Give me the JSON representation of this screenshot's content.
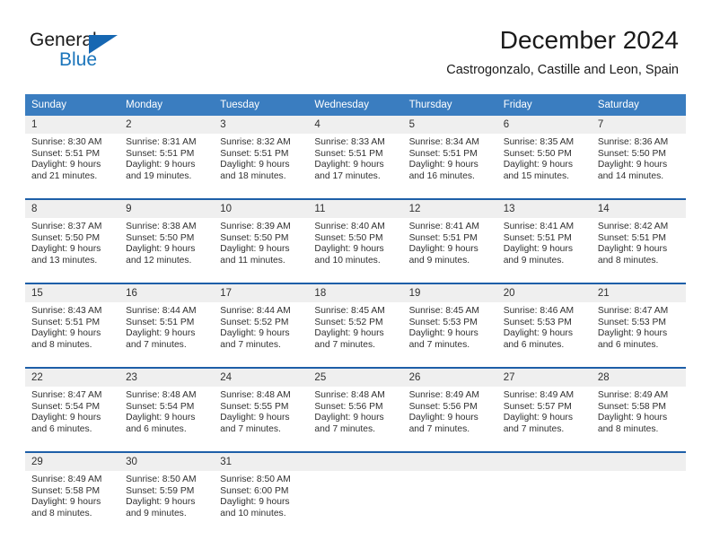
{
  "logo": {
    "word_one": "General",
    "word_two": "Blue",
    "triangle_icon": "blue-triangle-icon",
    "accent_color": "#1b75bb"
  },
  "header": {
    "title": "December 2024",
    "location": "Castrogonzalo, Castille and Leon, Spain"
  },
  "calendar": {
    "header_color": "#3a7dc0",
    "separator_color": "#1e5fa8",
    "daynum_band_color": "#efefef",
    "weekday_headers": [
      "Sunday",
      "Monday",
      "Tuesday",
      "Wednesday",
      "Thursday",
      "Friday",
      "Saturday"
    ],
    "weeks": [
      [
        {
          "day": "1",
          "sunrise": "Sunrise: 8:30 AM",
          "sunset": "Sunset: 5:51 PM",
          "daylight_1": "Daylight: 9 hours",
          "daylight_2": "and 21 minutes."
        },
        {
          "day": "2",
          "sunrise": "Sunrise: 8:31 AM",
          "sunset": "Sunset: 5:51 PM",
          "daylight_1": "Daylight: 9 hours",
          "daylight_2": "and 19 minutes."
        },
        {
          "day": "3",
          "sunrise": "Sunrise: 8:32 AM",
          "sunset": "Sunset: 5:51 PM",
          "daylight_1": "Daylight: 9 hours",
          "daylight_2": "and 18 minutes."
        },
        {
          "day": "4",
          "sunrise": "Sunrise: 8:33 AM",
          "sunset": "Sunset: 5:51 PM",
          "daylight_1": "Daylight: 9 hours",
          "daylight_2": "and 17 minutes."
        },
        {
          "day": "5",
          "sunrise": "Sunrise: 8:34 AM",
          "sunset": "Sunset: 5:51 PM",
          "daylight_1": "Daylight: 9 hours",
          "daylight_2": "and 16 minutes."
        },
        {
          "day": "6",
          "sunrise": "Sunrise: 8:35 AM",
          "sunset": "Sunset: 5:50 PM",
          "daylight_1": "Daylight: 9 hours",
          "daylight_2": "and 15 minutes."
        },
        {
          "day": "7",
          "sunrise": "Sunrise: 8:36 AM",
          "sunset": "Sunset: 5:50 PM",
          "daylight_1": "Daylight: 9 hours",
          "daylight_2": "and 14 minutes."
        }
      ],
      [
        {
          "day": "8",
          "sunrise": "Sunrise: 8:37 AM",
          "sunset": "Sunset: 5:50 PM",
          "daylight_1": "Daylight: 9 hours",
          "daylight_2": "and 13 minutes."
        },
        {
          "day": "9",
          "sunrise": "Sunrise: 8:38 AM",
          "sunset": "Sunset: 5:50 PM",
          "daylight_1": "Daylight: 9 hours",
          "daylight_2": "and 12 minutes."
        },
        {
          "day": "10",
          "sunrise": "Sunrise: 8:39 AM",
          "sunset": "Sunset: 5:50 PM",
          "daylight_1": "Daylight: 9 hours",
          "daylight_2": "and 11 minutes."
        },
        {
          "day": "11",
          "sunrise": "Sunrise: 8:40 AM",
          "sunset": "Sunset: 5:50 PM",
          "daylight_1": "Daylight: 9 hours",
          "daylight_2": "and 10 minutes."
        },
        {
          "day": "12",
          "sunrise": "Sunrise: 8:41 AM",
          "sunset": "Sunset: 5:51 PM",
          "daylight_1": "Daylight: 9 hours",
          "daylight_2": "and 9 minutes."
        },
        {
          "day": "13",
          "sunrise": "Sunrise: 8:41 AM",
          "sunset": "Sunset: 5:51 PM",
          "daylight_1": "Daylight: 9 hours",
          "daylight_2": "and 9 minutes."
        },
        {
          "day": "14",
          "sunrise": "Sunrise: 8:42 AM",
          "sunset": "Sunset: 5:51 PM",
          "daylight_1": "Daylight: 9 hours",
          "daylight_2": "and 8 minutes."
        }
      ],
      [
        {
          "day": "15",
          "sunrise": "Sunrise: 8:43 AM",
          "sunset": "Sunset: 5:51 PM",
          "daylight_1": "Daylight: 9 hours",
          "daylight_2": "and 8 minutes."
        },
        {
          "day": "16",
          "sunrise": "Sunrise: 8:44 AM",
          "sunset": "Sunset: 5:51 PM",
          "daylight_1": "Daylight: 9 hours",
          "daylight_2": "and 7 minutes."
        },
        {
          "day": "17",
          "sunrise": "Sunrise: 8:44 AM",
          "sunset": "Sunset: 5:52 PM",
          "daylight_1": "Daylight: 9 hours",
          "daylight_2": "and 7 minutes."
        },
        {
          "day": "18",
          "sunrise": "Sunrise: 8:45 AM",
          "sunset": "Sunset: 5:52 PM",
          "daylight_1": "Daylight: 9 hours",
          "daylight_2": "and 7 minutes."
        },
        {
          "day": "19",
          "sunrise": "Sunrise: 8:45 AM",
          "sunset": "Sunset: 5:53 PM",
          "daylight_1": "Daylight: 9 hours",
          "daylight_2": "and 7 minutes."
        },
        {
          "day": "20",
          "sunrise": "Sunrise: 8:46 AM",
          "sunset": "Sunset: 5:53 PM",
          "daylight_1": "Daylight: 9 hours",
          "daylight_2": "and 6 minutes."
        },
        {
          "day": "21",
          "sunrise": "Sunrise: 8:47 AM",
          "sunset": "Sunset: 5:53 PM",
          "daylight_1": "Daylight: 9 hours",
          "daylight_2": "and 6 minutes."
        }
      ],
      [
        {
          "day": "22",
          "sunrise": "Sunrise: 8:47 AM",
          "sunset": "Sunset: 5:54 PM",
          "daylight_1": "Daylight: 9 hours",
          "daylight_2": "and 6 minutes."
        },
        {
          "day": "23",
          "sunrise": "Sunrise: 8:48 AM",
          "sunset": "Sunset: 5:54 PM",
          "daylight_1": "Daylight: 9 hours",
          "daylight_2": "and 6 minutes."
        },
        {
          "day": "24",
          "sunrise": "Sunrise: 8:48 AM",
          "sunset": "Sunset: 5:55 PM",
          "daylight_1": "Daylight: 9 hours",
          "daylight_2": "and 7 minutes."
        },
        {
          "day": "25",
          "sunrise": "Sunrise: 8:48 AM",
          "sunset": "Sunset: 5:56 PM",
          "daylight_1": "Daylight: 9 hours",
          "daylight_2": "and 7 minutes."
        },
        {
          "day": "26",
          "sunrise": "Sunrise: 8:49 AM",
          "sunset": "Sunset: 5:56 PM",
          "daylight_1": "Daylight: 9 hours",
          "daylight_2": "and 7 minutes."
        },
        {
          "day": "27",
          "sunrise": "Sunrise: 8:49 AM",
          "sunset": "Sunset: 5:57 PM",
          "daylight_1": "Daylight: 9 hours",
          "daylight_2": "and 7 minutes."
        },
        {
          "day": "28",
          "sunrise": "Sunrise: 8:49 AM",
          "sunset": "Sunset: 5:58 PM",
          "daylight_1": "Daylight: 9 hours",
          "daylight_2": "and 8 minutes."
        }
      ],
      [
        {
          "day": "29",
          "sunrise": "Sunrise: 8:49 AM",
          "sunset": "Sunset: 5:58 PM",
          "daylight_1": "Daylight: 9 hours",
          "daylight_2": "and 8 minutes."
        },
        {
          "day": "30",
          "sunrise": "Sunrise: 8:50 AM",
          "sunset": "Sunset: 5:59 PM",
          "daylight_1": "Daylight: 9 hours",
          "daylight_2": "and 9 minutes."
        },
        {
          "day": "31",
          "sunrise": "Sunrise: 8:50 AM",
          "sunset": "Sunset: 6:00 PM",
          "daylight_1": "Daylight: 9 hours",
          "daylight_2": "and 10 minutes."
        },
        {
          "day": "",
          "sunrise": "",
          "sunset": "",
          "daylight_1": "",
          "daylight_2": ""
        },
        {
          "day": "",
          "sunrise": "",
          "sunset": "",
          "daylight_1": "",
          "daylight_2": ""
        },
        {
          "day": "",
          "sunrise": "",
          "sunset": "",
          "daylight_1": "",
          "daylight_2": ""
        },
        {
          "day": "",
          "sunrise": "",
          "sunset": "",
          "daylight_1": "",
          "daylight_2": ""
        }
      ]
    ]
  }
}
